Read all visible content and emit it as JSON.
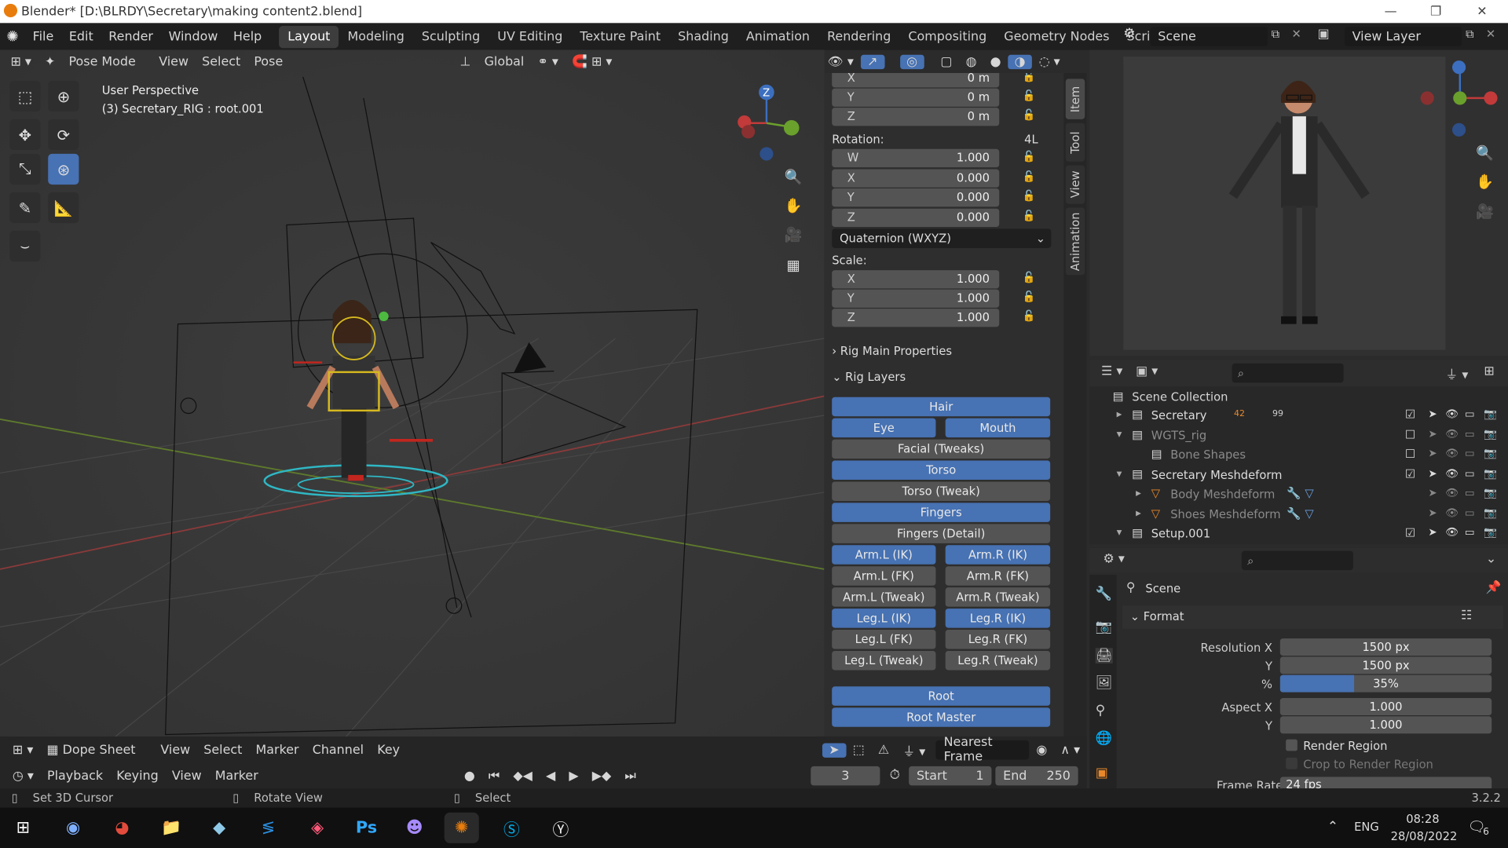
{
  "window": {
    "title": "Blender* [D:\\BLRDY\\Secretary\\making content2.blend]",
    "minimize": "—",
    "maximize": "❐",
    "close": "✕"
  },
  "menu": [
    "File",
    "Edit",
    "Render",
    "Window",
    "Help"
  ],
  "workspaces": [
    "Layout",
    "Modeling",
    "Sculpting",
    "UV Editing",
    "Texture Paint",
    "Shading",
    "Animation",
    "Rendering",
    "Compositing",
    "Geometry Nodes",
    "Scripting"
  ],
  "workspace_add": "+",
  "scene": {
    "name": "Scene",
    "view_layer": "View Layer"
  },
  "viewport_header": {
    "mode": "Pose Mode",
    "view": "View",
    "select": "Select",
    "pose": "Pose",
    "orientation": "Global"
  },
  "viewport": {
    "perspective": "User Perspective",
    "object_info": "(3) Secretary_RIG : root.001"
  },
  "gizmo_axes": {
    "z": "Z",
    "y": "Y",
    "x": "X"
  },
  "transform": {
    "location": [
      {
        "axis": "X",
        "value": "0 m"
      },
      {
        "axis": "Y",
        "value": "0 m"
      },
      {
        "axis": "Z",
        "value": "0 m"
      }
    ],
    "rotation_label": "Rotation:",
    "rotation_mode_tag": "4L",
    "rotation": [
      {
        "axis": "W",
        "value": "1.000"
      },
      {
        "axis": "X",
        "value": "0.000"
      },
      {
        "axis": "Y",
        "value": "0.000"
      },
      {
        "axis": "Z",
        "value": "0.000"
      }
    ],
    "rotation_mode": "Quaternion (WXYZ)",
    "scale_label": "Scale:",
    "scale": [
      {
        "axis": "X",
        "value": "1.000"
      },
      {
        "axis": "Y",
        "value": "1.000"
      },
      {
        "axis": "Z",
        "value": "1.000"
      }
    ]
  },
  "rig": {
    "main_props": "Rig Main Properties",
    "layers_label": "Rig Layers",
    "layers": [
      {
        "label": "Hair",
        "on": true
      },
      {
        "label": "Eye",
        "on": true
      },
      {
        "label": "Mouth",
        "on": true
      },
      {
        "label": "Facial (Tweaks)",
        "on": false
      },
      {
        "label": "Torso",
        "on": true
      },
      {
        "label": "Torso (Tweak)",
        "on": false
      },
      {
        "label": "Fingers",
        "on": true
      },
      {
        "label": "Fingers (Detail)",
        "on": false
      },
      {
        "label": "Arm.L (IK)",
        "on": true
      },
      {
        "label": "Arm.R (IK)",
        "on": true
      },
      {
        "label": "Arm.L (FK)",
        "on": false
      },
      {
        "label": "Arm.R (FK)",
        "on": false
      },
      {
        "label": "Arm.L (Tweak)",
        "on": false
      },
      {
        "label": "Arm.R (Tweak)",
        "on": false
      },
      {
        "label": "Leg.L (IK)",
        "on": true
      },
      {
        "label": "Leg.R (IK)",
        "on": true
      },
      {
        "label": "Leg.L (FK)",
        "on": false
      },
      {
        "label": "Leg.R (FK)",
        "on": false
      },
      {
        "label": "Leg.L (Tweak)",
        "on": false
      },
      {
        "label": "Leg.R (Tweak)",
        "on": false
      },
      {
        "label": "Root",
        "on": true
      },
      {
        "label": "Root Master",
        "on": true
      }
    ]
  },
  "sidebar_tabs": [
    "Item",
    "Tool",
    "View",
    "Animation"
  ],
  "outliner": {
    "root": "Scene Collection",
    "items": [
      {
        "label": "Secretary",
        "badge1": "42",
        "badge2": "99"
      },
      {
        "label": "WGTS_rig"
      },
      {
        "label": "Bone Shapes"
      },
      {
        "label": "Secretary Meshdeform"
      },
      {
        "label": "Body Meshdeform"
      },
      {
        "label": "Shoes Meshdeform"
      },
      {
        "label": "Setup.001"
      }
    ]
  },
  "properties": {
    "context": "Scene",
    "panel": "Format",
    "fields": [
      {
        "label": "Resolution X",
        "value": "1500 px"
      },
      {
        "label": "Y",
        "value": "1500 px"
      },
      {
        "label": "%",
        "value": "35%",
        "fill": 0.35
      },
      {
        "label": "Aspect X",
        "value": "1.000"
      },
      {
        "label": "Y",
        "value": "1.000"
      }
    ],
    "render_region": "Render Region",
    "crop": "Crop to Render Region",
    "frame_rate_label": "Frame Rate",
    "frame_rate": "24 fps"
  },
  "dopesheet": {
    "editor": "Dope Sheet",
    "menus": [
      "View",
      "Select",
      "Marker",
      "Channel",
      "Key"
    ],
    "snap": "Nearest Frame"
  },
  "timeline": {
    "playback": "Playback",
    "keying": "Keying",
    "view": "View",
    "marker": "Marker",
    "current_frame": "3",
    "start_label": "Start",
    "start": "1",
    "end_label": "End",
    "end": "250"
  },
  "statusbar": {
    "left": "Set 3D Cursor",
    "mid": "Rotate View",
    "right": "Select",
    "version": "3.2.2"
  },
  "taskbar": {
    "lang": "ENG",
    "time": "08:28",
    "date": "28/08/2022",
    "notifications": "6"
  }
}
